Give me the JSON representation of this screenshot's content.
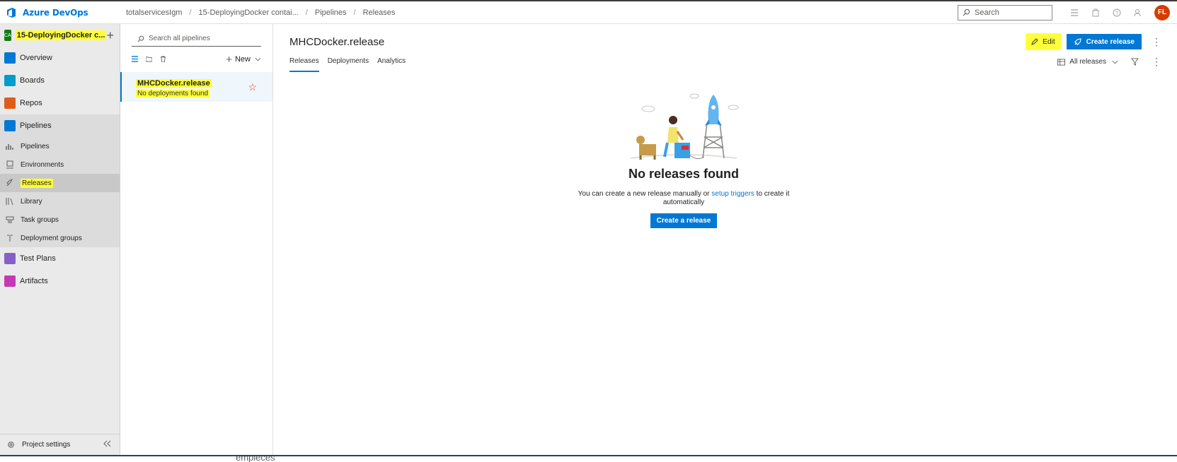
{
  "app": {
    "name": "Azure DevOps"
  },
  "breadcrumb": [
    "totalservicesIgm",
    "15-DeployingDocker contai...",
    "Pipelines",
    "Releases"
  ],
  "header": {
    "search_placeholder": "Search",
    "avatar_initials": "FL"
  },
  "project": {
    "badge": "CA",
    "name": "15-DeployingDocker c..."
  },
  "sidebar": {
    "items": [
      {
        "label": "Overview",
        "icon": "overview-icon",
        "color": "#0078d4"
      },
      {
        "label": "Boards",
        "icon": "boards-icon",
        "color": "#009ccc"
      },
      {
        "label": "Repos",
        "icon": "repos-icon",
        "color": "#e05c1a"
      },
      {
        "label": "Pipelines",
        "icon": "pipelines-icon",
        "color": "#0078d4"
      }
    ],
    "pipeline_sub": [
      {
        "label": "Pipelines",
        "icon": "pipelines-sub-icon"
      },
      {
        "label": "Environments",
        "icon": "environments-icon"
      },
      {
        "label": "Releases",
        "icon": "releases-icon",
        "active": true
      },
      {
        "label": "Library",
        "icon": "library-icon"
      },
      {
        "label": "Task groups",
        "icon": "task-groups-icon"
      },
      {
        "label": "Deployment groups",
        "icon": "deployment-groups-icon"
      }
    ],
    "bottom_items": [
      {
        "label": "Test Plans",
        "icon": "test-plans-icon",
        "color": "#8661c5"
      },
      {
        "label": "Artifacts",
        "icon": "artifacts-icon",
        "color": "#c239b3"
      }
    ],
    "settings_label": "Project settings"
  },
  "list": {
    "search_placeholder": "Search all pipelines",
    "new_label": "New",
    "selected_pipeline": {
      "name": "MHCDocker.release",
      "status": "No deployments found"
    }
  },
  "main": {
    "title": "MHCDocker.release",
    "tabs": [
      "Releases",
      "Deployments",
      "Analytics"
    ],
    "edit_label": "Edit",
    "create_release_label": "Create release",
    "filter_label": "All releases",
    "empty": {
      "title": "No releases found",
      "text_before": "You can create a new release manually or ",
      "link": "setup triggers",
      "text_after": " to create it automatically",
      "button": "Create a release"
    }
  },
  "taskbar": {
    "text": "empieces"
  }
}
